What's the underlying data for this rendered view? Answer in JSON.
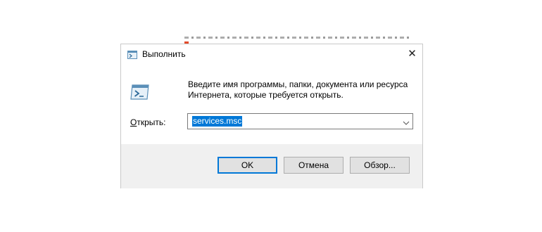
{
  "dialog": {
    "title": "Выполнить",
    "close_label": "✕",
    "prompt_line1": "Введите имя программы, папки, документа или ресурса",
    "prompt_line2": "Интернета, которые требуется открыть.",
    "open_label_underlined": "О",
    "open_label_rest": "ткрыть:",
    "input_value": "services.msc",
    "buttons": {
      "ok": "OK",
      "cancel": "Отмена",
      "browse": "Обзор..."
    }
  },
  "icons": {
    "title": "run-app-icon",
    "main": "run-app-icon-large",
    "dropdown": "chevron-down-icon",
    "close": "close-icon"
  },
  "colors": {
    "selection": "#0078d7",
    "footer_bg": "#f0f0f0",
    "button_bg": "#e1e1e1",
    "default_button_border": "#0078d7"
  }
}
